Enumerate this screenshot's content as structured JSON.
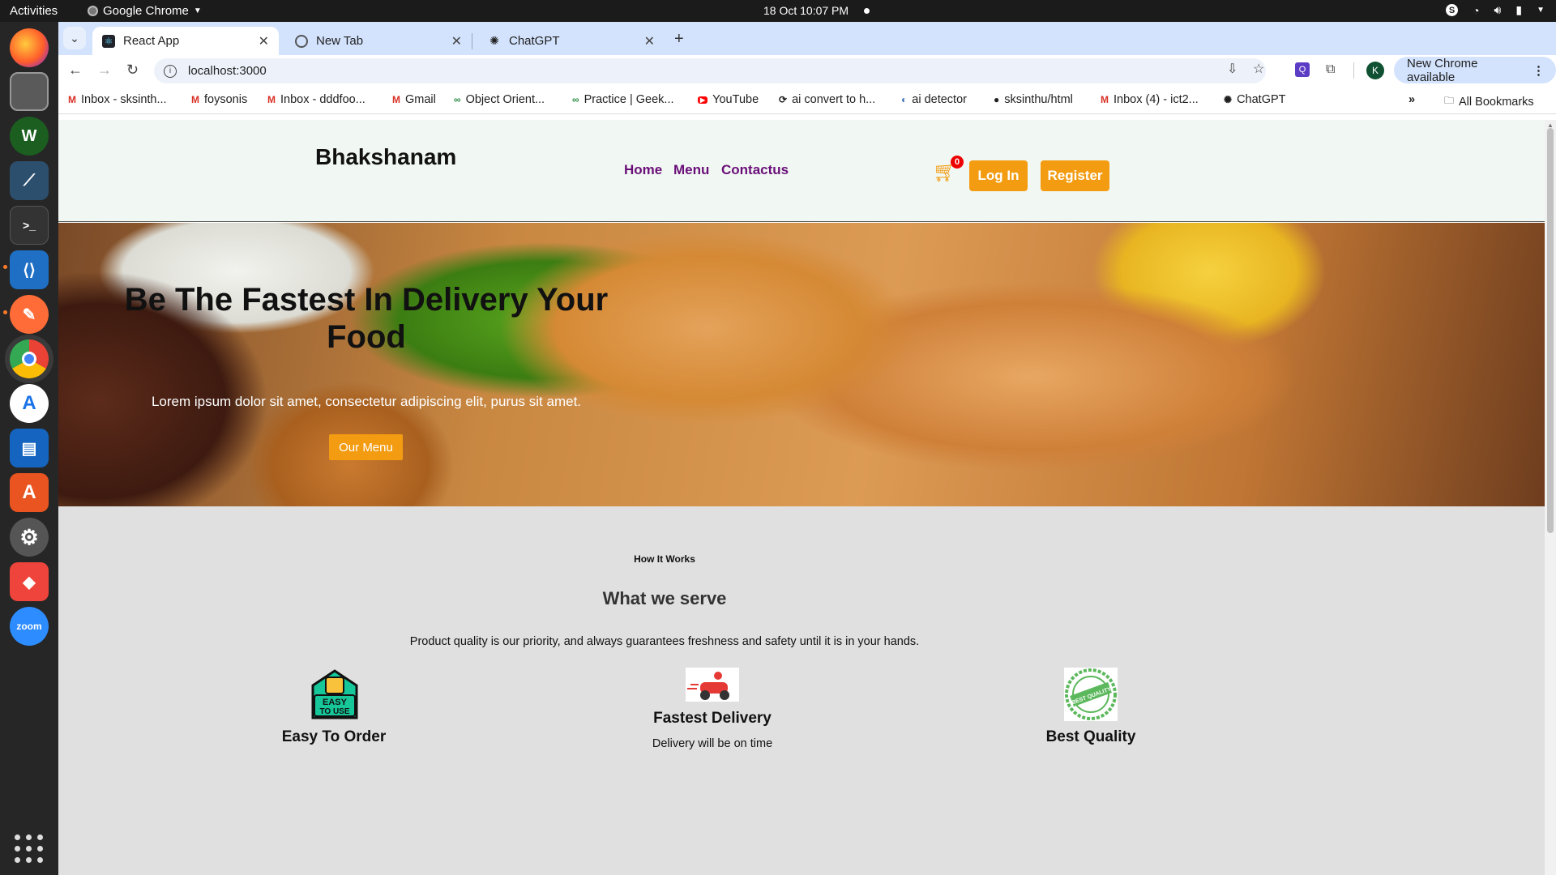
{
  "system": {
    "activities": "Activities",
    "app_name": "Google Chrome",
    "clock": "18 Oct  10:07 PM"
  },
  "browser": {
    "tabs": [
      {
        "title": "React App",
        "active": true
      },
      {
        "title": "New Tab",
        "active": false
      },
      {
        "title": "ChatGPT",
        "active": false
      }
    ],
    "address": "localhost:3000",
    "avatar_letter": "K",
    "update_label": "New Chrome available",
    "bookmarks": [
      {
        "label": "Inbox - sksinth...",
        "icon": "gmail-icon"
      },
      {
        "label": "foysonis",
        "icon": "gmail-icon"
      },
      {
        "label": "Inbox - dddfoo...",
        "icon": "gmail-icon"
      },
      {
        "label": "Gmail",
        "icon": "gmail-icon"
      },
      {
        "label": "Object Orient...",
        "icon": "gfg-icon"
      },
      {
        "label": "Practice | Geek...",
        "icon": "gfg-icon"
      },
      {
        "label": "YouTube",
        "icon": "youtube-icon"
      },
      {
        "label": "ai convert to  h...",
        "icon": "ai-convert-icon"
      },
      {
        "label": "ai detector",
        "icon": "ai-detector-icon"
      },
      {
        "label": "sksinthu/html",
        "icon": "github-icon"
      },
      {
        "label": "Inbox (4) - ict2...",
        "icon": "gmail-icon"
      },
      {
        "label": "ChatGPT",
        "icon": "chatgpt-icon"
      }
    ],
    "all_bookmarks": "All Bookmarks"
  },
  "site": {
    "brand": "Bhakshanam",
    "nav": [
      "Home",
      "Menu",
      "Contactus"
    ],
    "cart_count": "0",
    "login_label": "Log In",
    "register_label": "Register",
    "accent_color": "#f39c12",
    "nav_link_color": "#6a0f7a",
    "hero": {
      "title": "Be The Fastest In Delivery Your Food",
      "subtitle": "Lorem ipsum dolor sit amet, consectetur adipiscing elit, purus sit amet.",
      "button": "Our Menu"
    },
    "how": {
      "eyebrow": "How It Works",
      "title": "What we serve",
      "description": "Product quality is our priority, and always guarantees freshness and safety until it is in your hands.",
      "features": [
        {
          "title": "Easy To Order",
          "description": "",
          "icon": "easy-to-use-icon"
        },
        {
          "title": "Fastest Delivery",
          "description": "Delivery will be on time",
          "icon": "delivery-scooter-icon"
        },
        {
          "title": "Best Quality",
          "description": "",
          "icon": "best-quality-seal-icon"
        }
      ]
    }
  }
}
